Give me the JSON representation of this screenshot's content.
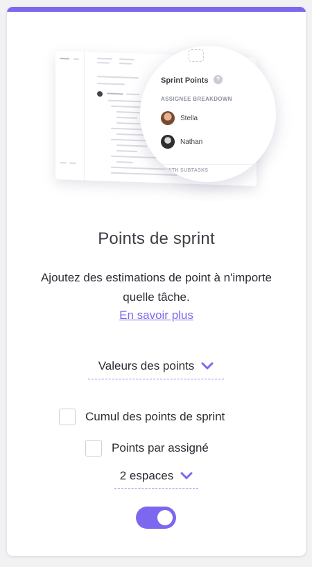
{
  "illustration": {
    "panel_title": "Sprint Points",
    "help_glyph": "?",
    "breakdown_heading": "ASSIGNEE BREAKDOWN",
    "assignees": [
      {
        "name": "Stella"
      },
      {
        "name": "Nathan"
      }
    ],
    "footer_text": "L WITH SUBTASKS"
  },
  "feature": {
    "title": "Points de sprint",
    "description": "Ajoutez des estimations de point à n'importe quelle tâche.",
    "learn_more": "En savoir plus"
  },
  "controls": {
    "values_dropdown": {
      "label": "Valeurs des points",
      "icon": "chevron-down-icon"
    },
    "cumulative_checkbox": {
      "label": "Cumul des points de sprint",
      "checked": false
    },
    "per_assignee_checkbox": {
      "label": "Points par assigné",
      "checked": false
    },
    "spaces_dropdown": {
      "label": "2 espaces",
      "icon": "chevron-down-icon"
    },
    "enable_toggle": {
      "on": true
    }
  },
  "colors": {
    "accent": "#7b68ee",
    "text": "#2a2e34",
    "title": "#3c3f45"
  }
}
